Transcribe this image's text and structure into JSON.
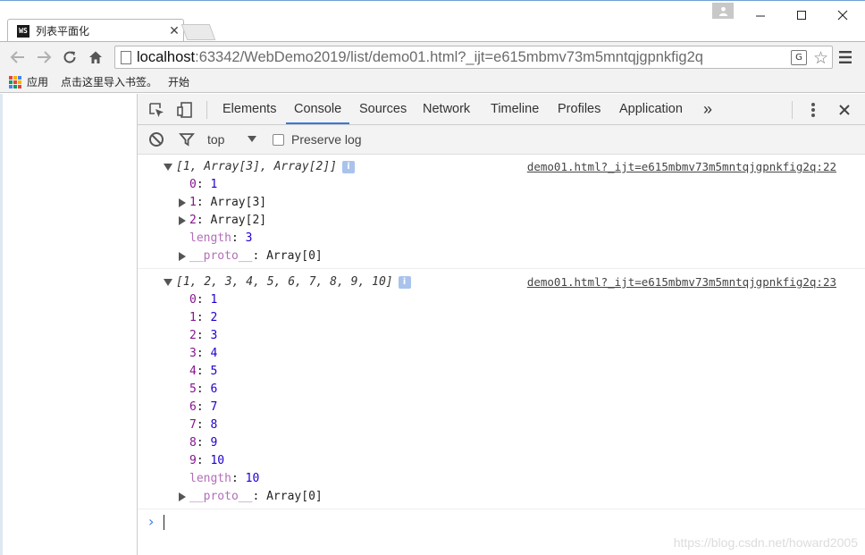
{
  "browser": {
    "tab_title": "列表平面化",
    "favicon_text": "WS",
    "url_host": "localhost",
    "url_rest": ":63342/WebDemo2019/list/demo01.html?_ijt=e615mbmv73m5mntqjgpnkfig2q",
    "translate_icon": "translate-icon",
    "bookmarks": [
      "应用",
      "点击这里导入书签。",
      "开始"
    ]
  },
  "devtools": {
    "tabs": [
      "Elements",
      "Console",
      "Sources",
      "Network",
      "Timeline",
      "Profiles",
      "Application"
    ],
    "more_label": "»",
    "active_tab": "Console",
    "context": "top",
    "preserve_log_label": "Preserve log",
    "preserve_log_checked": false
  },
  "console": {
    "messages": [
      {
        "summary": "[1, Array[3], Array[2]]",
        "source": "demo01.html?_ijt=e615mbmv73m5mntqjgpnkfig2q:22",
        "entries": [
          {
            "key": "0",
            "value": "1",
            "type": "number",
            "expandable": false
          },
          {
            "key": "1",
            "value": "Array[3]",
            "type": "object",
            "expandable": true
          },
          {
            "key": "2",
            "value": "Array[2]",
            "type": "object",
            "expandable": true
          },
          {
            "key": "length",
            "value": "3",
            "type": "number",
            "expandable": false,
            "dim": true
          },
          {
            "key": "__proto__",
            "value": "Array[0]",
            "type": "object",
            "expandable": true,
            "dim": true
          }
        ]
      },
      {
        "summary": "[1, 2, 3, 4, 5, 6, 7, 8, 9, 10]",
        "source": "demo01.html?_ijt=e615mbmv73m5mntqjgpnkfig2q:23",
        "entries": [
          {
            "key": "0",
            "value": "1",
            "type": "number",
            "expandable": false
          },
          {
            "key": "1",
            "value": "2",
            "type": "number",
            "expandable": false
          },
          {
            "key": "2",
            "value": "3",
            "type": "number",
            "expandable": false
          },
          {
            "key": "3",
            "value": "4",
            "type": "number",
            "expandable": false
          },
          {
            "key": "4",
            "value": "5",
            "type": "number",
            "expandable": false
          },
          {
            "key": "5",
            "value": "6",
            "type": "number",
            "expandable": false
          },
          {
            "key": "6",
            "value": "7",
            "type": "number",
            "expandable": false
          },
          {
            "key": "7",
            "value": "8",
            "type": "number",
            "expandable": false
          },
          {
            "key": "8",
            "value": "9",
            "type": "number",
            "expandable": false
          },
          {
            "key": "9",
            "value": "10",
            "type": "number",
            "expandable": false
          },
          {
            "key": "length",
            "value": "10",
            "type": "number",
            "expandable": false,
            "dim": true
          },
          {
            "key": "__proto__",
            "value": "Array[0]",
            "type": "object",
            "expandable": true,
            "dim": true
          }
        ]
      }
    ],
    "prompt_symbol": "›"
  },
  "watermark": "https://blog.csdn.net/howard2005",
  "colors": {
    "accent": "#3879d9",
    "key": "#881391",
    "number": "#1c00cf",
    "prompt": "#367cf1"
  }
}
